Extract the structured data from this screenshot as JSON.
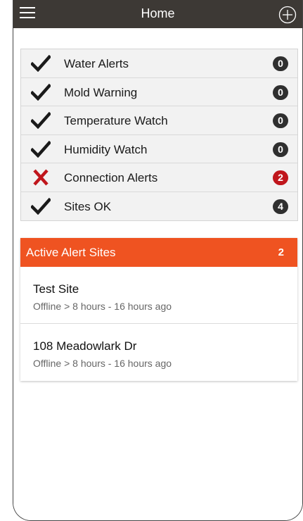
{
  "header": {
    "title": "Home",
    "menu_icon": "hamburger-menu-icon",
    "add_icon": "add-circle-icon",
    "background": "#3d3935"
  },
  "summary": [
    {
      "status": "ok",
      "label": "Water Alerts",
      "count": "0"
    },
    {
      "status": "ok",
      "label": "Mold Warning",
      "count": "0"
    },
    {
      "status": "ok",
      "label": "Temperature Watch",
      "count": "0"
    },
    {
      "status": "ok",
      "label": "Humidity Watch",
      "count": "0"
    },
    {
      "status": "error",
      "label": "Connection Alerts",
      "count": "2"
    },
    {
      "status": "ok",
      "label": "Sites OK",
      "count": "4"
    }
  ],
  "colors": {
    "ok_check": "#1a1a1a",
    "error_x": "#c0161c",
    "alert_badge": "#c0161c",
    "default_badge": "#2f2f2f",
    "alerts_header": "#ef5321"
  },
  "alerts": {
    "title": "Active Alert Sites",
    "count": "2",
    "sites": [
      {
        "name": "Test Site",
        "detail": "Offline > 8 hours - 16 hours ago"
      },
      {
        "name": "108 Meadowlark Dr",
        "detail": "Offline > 8 hours - 16 hours ago"
      }
    ]
  }
}
